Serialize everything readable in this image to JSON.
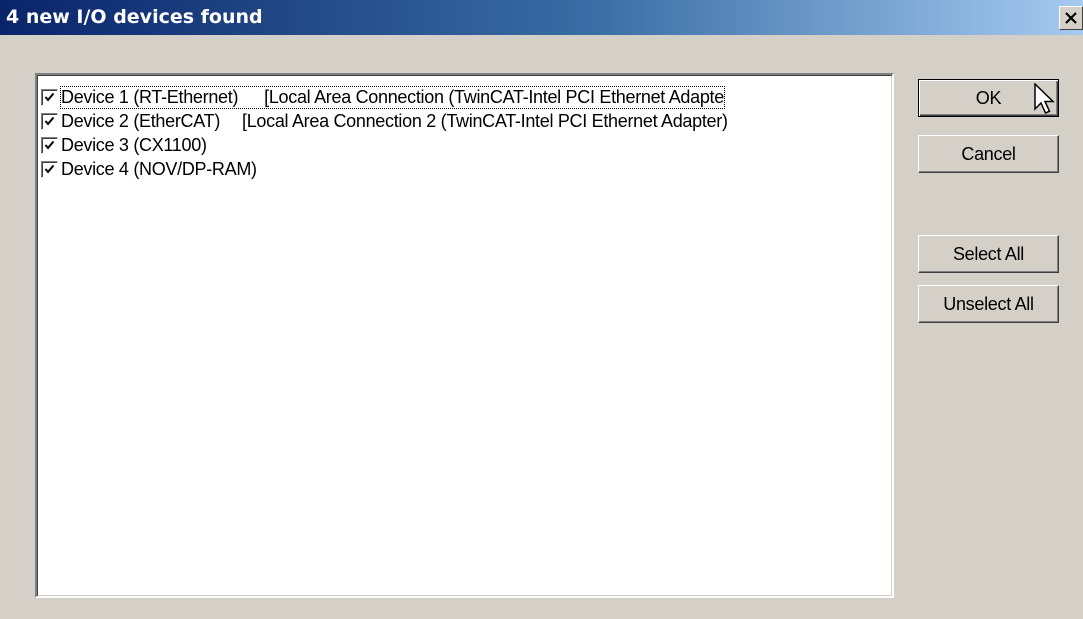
{
  "dialog": {
    "title": "4 new I/O devices found"
  },
  "devices": [
    {
      "name": "Device 1 (RT-Ethernet)",
      "detail": "[Local Area Connection (TwinCAT-Intel PCI Ethernet Adapte",
      "checked": true
    },
    {
      "name": "Device 2 (EtherCAT)",
      "detail": "[Local Area Connection 2 (TwinCAT-Intel PCI Ethernet Adapter)",
      "checked": true
    },
    {
      "name": "Device 3 (CX1100)",
      "detail": "",
      "checked": true
    },
    {
      "name": "Device 4 (NOV/DP-RAM)",
      "detail": "",
      "checked": true
    }
  ],
  "buttons": {
    "ok": "OK",
    "cancel": "Cancel",
    "select_all": "Select All",
    "unselect_all": "Unselect All"
  },
  "icons": {
    "close": "close-icon",
    "checkmark": "checkmark-icon",
    "cursor": "mouse-pointer-icon"
  },
  "colors": {
    "titlebar_start": "#0a246a",
    "titlebar_end": "#a6caf0",
    "face": "#d4d0c8"
  }
}
